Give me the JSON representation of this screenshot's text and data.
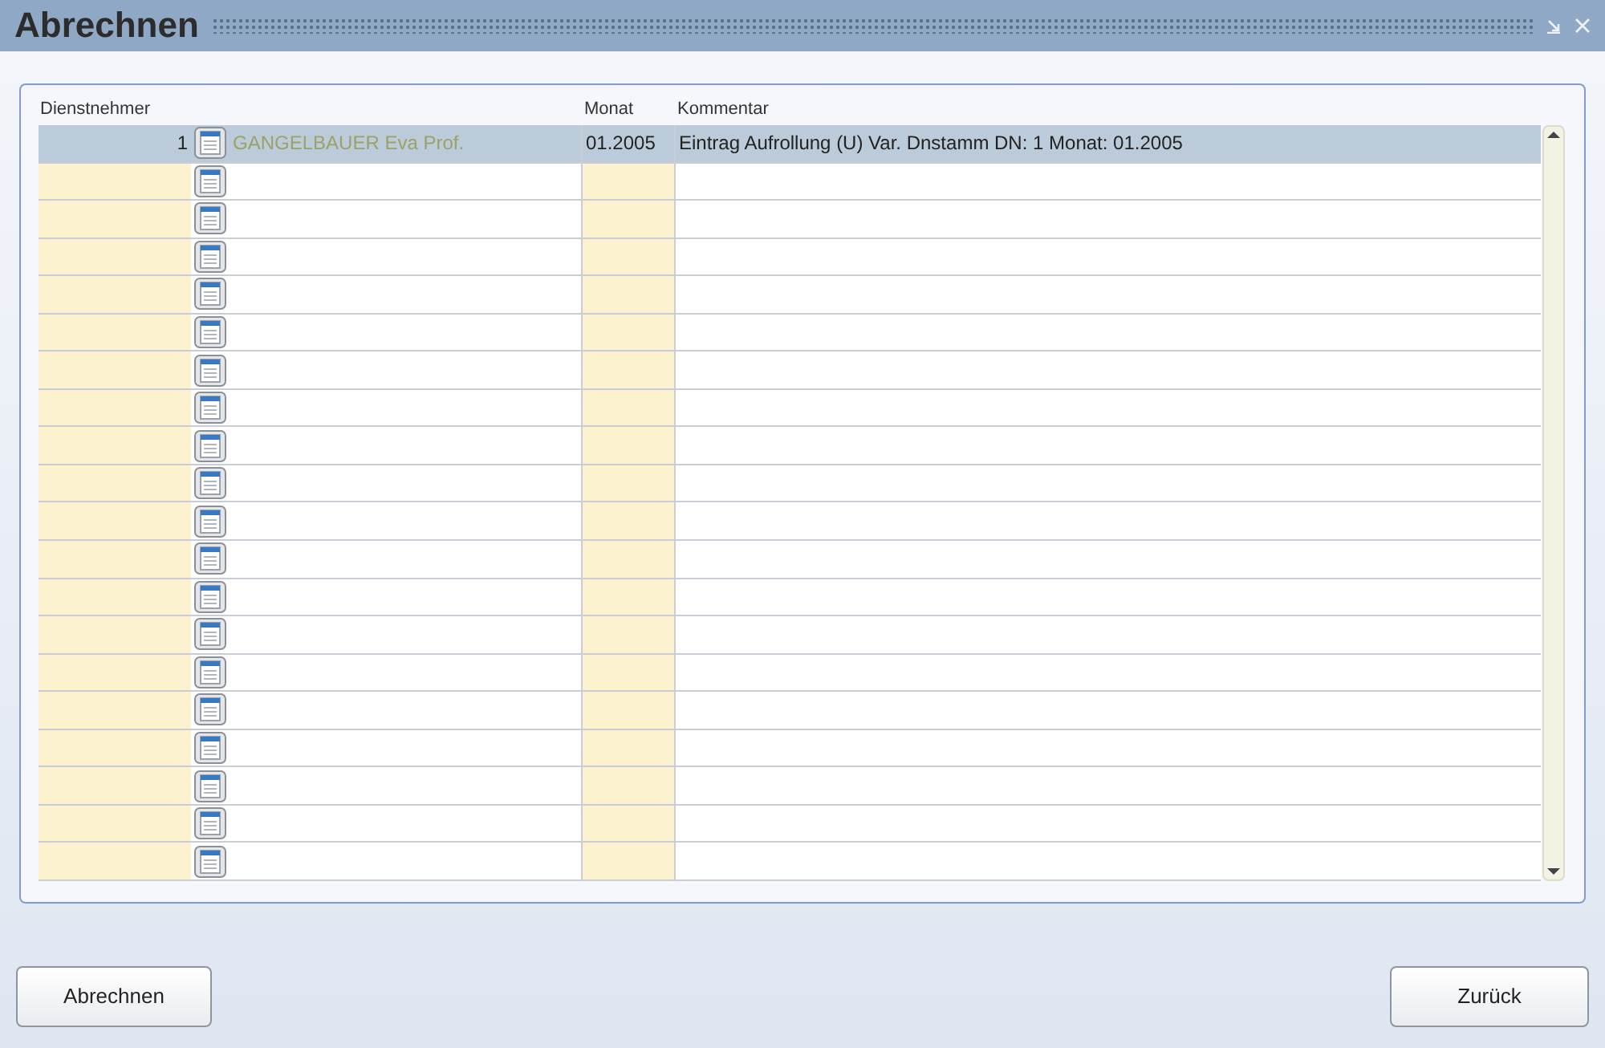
{
  "window": {
    "title": "Abrechnen"
  },
  "table": {
    "columns": [
      "Dienstnehmer",
      "Monat",
      "Kommentar"
    ],
    "rows": [
      {
        "number": "1",
        "name": "GANGELBAUER Eva Prof.",
        "month": "01.2005",
        "comment": "Eintrag Aufrollung (U) Var. Dnstamm DN: 1 Monat: 01.2005",
        "selected": true
      },
      {
        "selected": false
      },
      {
        "selected": false
      },
      {
        "selected": false
      },
      {
        "selected": false
      },
      {
        "selected": false
      },
      {
        "selected": false
      },
      {
        "selected": false
      },
      {
        "selected": false
      },
      {
        "selected": false
      },
      {
        "selected": false
      },
      {
        "selected": false
      },
      {
        "selected": false
      },
      {
        "selected": false
      },
      {
        "selected": false
      },
      {
        "selected": false
      },
      {
        "selected": false
      },
      {
        "selected": false
      },
      {
        "selected": false
      },
      {
        "selected": false
      }
    ]
  },
  "buttons": [
    "Abrechnen",
    "Zurück"
  ]
}
